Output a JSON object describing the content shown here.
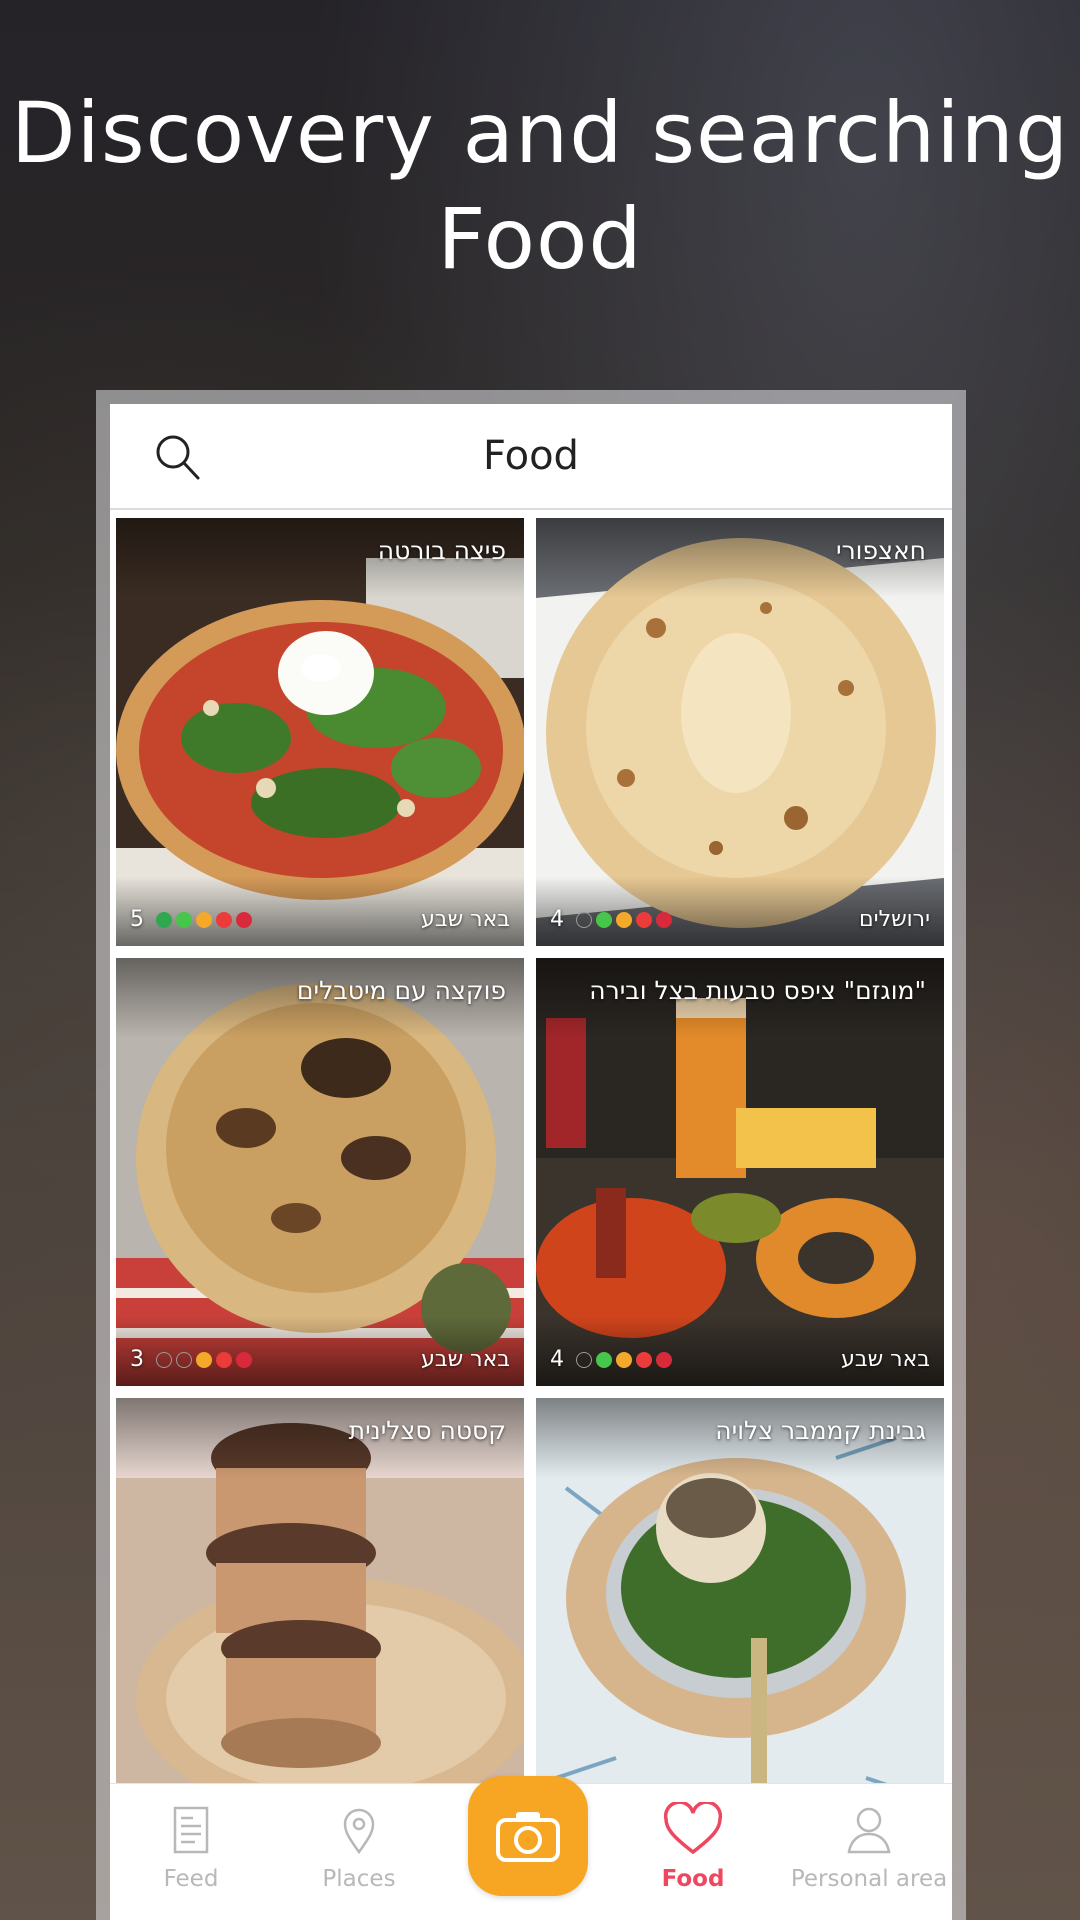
{
  "promo": {
    "line1": "Discovery and searching",
    "line2": "Food"
  },
  "header": {
    "title": "Food",
    "search_icon": "search-icon"
  },
  "cards": [
    {
      "name": "פיצה בורטה",
      "city": "באר שבע",
      "rating": 5,
      "dots_filled": 5
    },
    {
      "name": "חאצפורי",
      "city": "ירושלים",
      "rating": 4,
      "dots_filled": 4
    },
    {
      "name": "פוקצה עם מיטבלים",
      "city": "באר שבע",
      "rating": 3,
      "dots_filled": 3
    },
    {
      "name": "\"מוגזם\" ציפס טבעות בצל ובירה",
      "city": "באר שבע",
      "rating": 4,
      "dots_filled": 4
    },
    {
      "name": "קסטה סצלינית",
      "city": "",
      "rating": "",
      "dots_filled": 0
    },
    {
      "name": "גבינת קממבר צלויה",
      "city": "",
      "rating": "",
      "dots_filled": 0
    }
  ],
  "tabbar": {
    "feed": "Feed",
    "places": "Places",
    "camera_icon": "camera-icon",
    "food": "Food",
    "personal": "Personal area",
    "active": "food"
  },
  "colors": {
    "accent": "#f7a623",
    "active_tab": "#ee4760",
    "inactive_tab": "#b8b8b8"
  }
}
